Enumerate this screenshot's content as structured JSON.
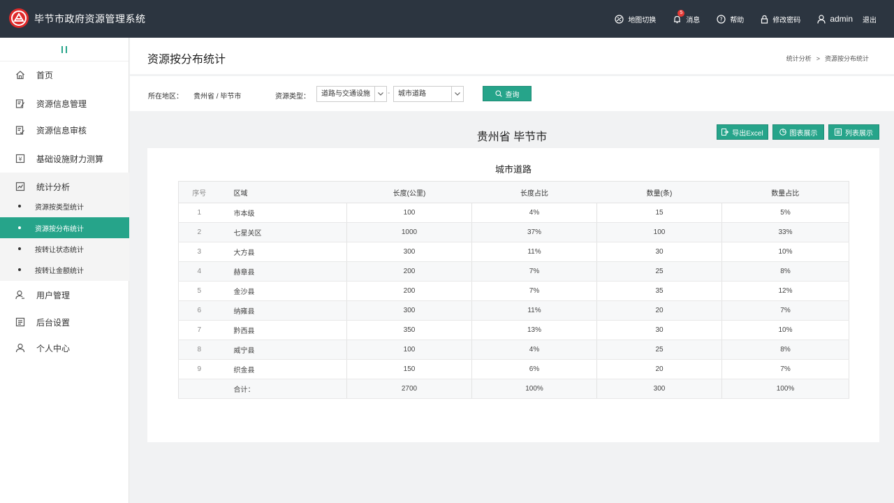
{
  "app": {
    "title": "毕节市政府资源管理系统"
  },
  "topnav": {
    "map_switch": "地图切换",
    "messages": "消息",
    "message_count": "5",
    "help": "帮助",
    "change_password": "修改密码",
    "username": "admin",
    "logout": "退出"
  },
  "sidebar": {
    "collapse": "II",
    "items": [
      {
        "label": "首页",
        "icon": "home-icon"
      },
      {
        "label": "资源信息管理",
        "icon": "edit-doc-icon"
      },
      {
        "label": "资源信息审核",
        "icon": "review-doc-icon"
      },
      {
        "label": "基础设施财力测算",
        "icon": "yuan-calc-icon"
      },
      {
        "label": "统计分析",
        "icon": "chart-icon"
      },
      {
        "label": "用户管理",
        "icon": "user-manage-icon"
      },
      {
        "label": "后台设置",
        "icon": "settings-list-icon"
      },
      {
        "label": "个人中心",
        "icon": "person-icon"
      }
    ],
    "sub_items": [
      {
        "label": "资源按类型统计",
        "active": false
      },
      {
        "label": "资源按分布统计",
        "active": true
      },
      {
        "label": "按转让状态统计",
        "active": false
      },
      {
        "label": "按转让金额统计",
        "active": false
      }
    ]
  },
  "page": {
    "title": "资源按分布统计",
    "breadcrumb": [
      "统计分析",
      ">",
      "资源按分布统计"
    ]
  },
  "filters": {
    "region_label": "所在地区：",
    "region_value": "贵州省 / 毕节市",
    "type_label": "资源类型：",
    "type_select": "道路与交通设施",
    "dash": "-",
    "subtype_select": "城市道路",
    "query_button": "查询"
  },
  "actions": {
    "region_title": "贵州省 毕节市",
    "export": "导出Excel",
    "chart_view": "图表展示",
    "list_view": "列表展示"
  },
  "table": {
    "title": "城市道路",
    "headers": [
      "序号",
      "区域",
      "长度(公里)",
      "长度占比",
      "数量(条)",
      "数量占比"
    ],
    "rows": [
      [
        "1",
        "市本级",
        "100",
        "4%",
        "15",
        "5%"
      ],
      [
        "2",
        "七星关区",
        "1000",
        "37%",
        "100",
        "33%"
      ],
      [
        "3",
        "大方县",
        "300",
        "11%",
        "30",
        "10%"
      ],
      [
        "4",
        "赫章县",
        "200",
        "7%",
        "25",
        "8%"
      ],
      [
        "5",
        "金沙县",
        "200",
        "7%",
        "35",
        "12%"
      ],
      [
        "6",
        "纳雍县",
        "300",
        "11%",
        "20",
        "7%"
      ],
      [
        "7",
        "黔西县",
        "350",
        "13%",
        "30",
        "10%"
      ],
      [
        "8",
        "威宁县",
        "100",
        "4%",
        "25",
        "8%"
      ],
      [
        "9",
        "织金县",
        "150",
        "6%",
        "20",
        "7%"
      ]
    ],
    "total": [
      "",
      "合计：",
      "2700",
      "100%",
      "300",
      "100%"
    ]
  },
  "colors": {
    "accent": "#26a48a",
    "topbar": "#2c3540",
    "logo": "#e02a2a"
  }
}
